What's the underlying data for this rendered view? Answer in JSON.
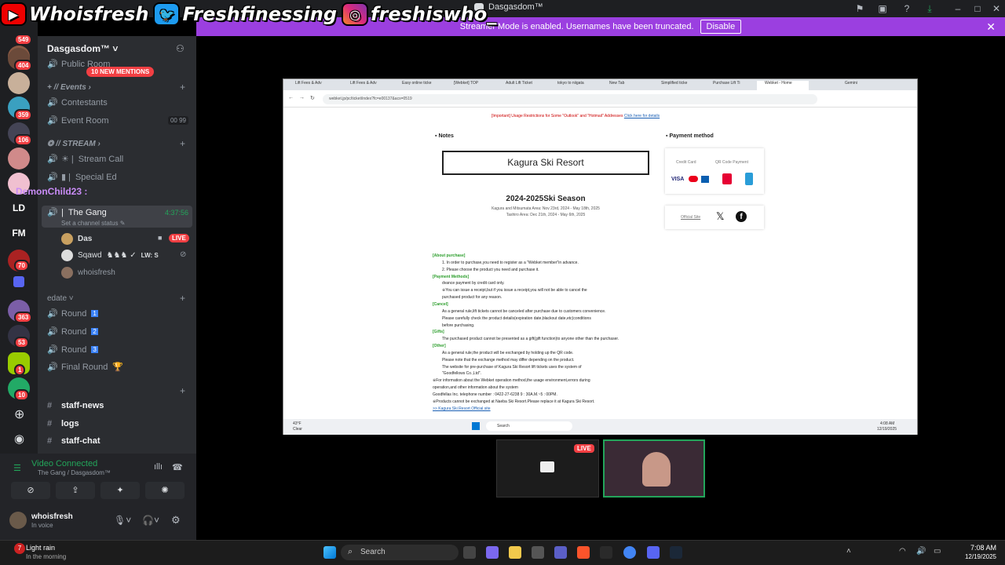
{
  "overlay": {
    "youtube": "Whoisfresh",
    "twitter": "Freshfinessing",
    "instagram": "freshiswho_"
  },
  "window": {
    "title": "Dasgasdom™"
  },
  "banner": {
    "text": "Streamer Mode is enabled. Usernames have been truncated.",
    "button": "Disable"
  },
  "rail": {
    "badges": [
      "549",
      "404",
      "359",
      "106",
      "70",
      "363",
      "53",
      "1",
      "10"
    ],
    "text_items": [
      "LD",
      "FM"
    ]
  },
  "server": {
    "name": "Dasgasdom™",
    "mentions": "10 NEW MENTIONS"
  },
  "channels": {
    "public_room": "Public Room",
    "events_cat": "// Events",
    "contestants": "Contestants",
    "event_room": "Event Room",
    "event_room_badge_1": "00",
    "event_room_badge_2": "99",
    "stream_cat": "// STREAM",
    "stream_call": "Stream Call",
    "special_ed": "Special Ed",
    "the_gang": "The Gang",
    "gang_time": "4:37:56",
    "gang_status": "Set a channel status",
    "voice_users": [
      "Das",
      "Sqawd",
      "whoisfresh"
    ],
    "sqawd_tag": "LW: S",
    "live": "LIVE",
    "edate_cat": "edate",
    "round1": "Round",
    "round2": "Round",
    "round3": "Round",
    "final_round": "Final Round",
    "staff_news": "staff-news",
    "logs": "logs",
    "staff_chat": "staff-chat"
  },
  "typing_user": "DemonChild23 :",
  "voice": {
    "title": "Video Connected",
    "sub": "The Gang / Dasgasdom™"
  },
  "user": {
    "name": "whoisfresh",
    "status": "In voice"
  },
  "browser": {
    "tabs": [
      "Lift Fees & Adv",
      "Lift Fees & Adv",
      "Easy online ticke",
      "[Webket] TOP",
      "Adult Lift Ticket",
      "tokyo to niigata",
      "New Tab",
      "Simplified ticke",
      "Purchase Lift Ti",
      "Webket - Home"
    ],
    "gemini": "Gemini",
    "url": "webket.jp/pc/ticket/index?fc=e00137&acs=0519",
    "notice": "[Important] Usage Restrictions for Some \"Outlook\" and \"Hotmail\" Addresses",
    "notice_link": "Click here for details",
    "notes_heading": "Notes",
    "payment_heading": "Payment method",
    "resort": "Kagura Ski Resort",
    "season": "2024-2025Ski Season",
    "season_line1": "Kagura and Mitsumata Area: Nov 23rd, 2024 - May 18th, 2025",
    "season_line2": "Tashiro Area: Dec 21th, 2024 - May 6th, 2025",
    "credit_card": "Credit Card",
    "qr_payment": "QR Code Payment",
    "official_site": "Official Site",
    "info": [
      {
        "t": "[About purchase]",
        "s": "g"
      },
      {
        "t": "1.  In order to purchase,you need to register as a \"Webket member\"in advance.",
        "s": "i"
      },
      {
        "t": "2.  Please choose the product you need and purchase it.",
        "s": "i"
      },
      {
        "t": "[Payment Methods]",
        "s": "g"
      },
      {
        "t": "dvance payment by credit card only.",
        "s": "i"
      },
      {
        "t": "※You can issue a receipt,but if you issue a receipt,you will not be able to cancel the",
        "s": "i"
      },
      {
        "t": "purchased product for any reason.",
        "s": "i"
      },
      {
        "t": "[Cancel]",
        "s": "g"
      },
      {
        "t": "As a general rule,lift tickets cannot be canceled after purchase due to customers convenience.",
        "s": "i"
      },
      {
        "t": "Please carefully check the product details(expiration date,blackout date,etc)conditions",
        "s": "i"
      },
      {
        "t": "before purchasing.",
        "s": "i"
      },
      {
        "t": "[Gifts]",
        "s": "g"
      },
      {
        "t": "The purchased product cannot be presented as a gift(gift function)to anyone other than the purchaser.",
        "s": "i"
      },
      {
        "t": "[Other]",
        "s": "g"
      },
      {
        "t": "As a general rule,the product will be exchanged by holding up the QR code.",
        "s": "i"
      },
      {
        "t": "Please note that the exchange method may differ depending on the product.",
        "s": "i"
      },
      {
        "t": "The website for pre-purchase of Kagura Ski Resort lift tickets uses the system of",
        "s": "i"
      },
      {
        "t": "\"Goodfellows Co.,Ltd\".",
        "s": "i"
      },
      {
        "t": "※For information about the Webket operation method,the usage environment,errors during",
        "s": "n"
      },
      {
        "t": "operation,and other information about the system",
        "s": "n"
      },
      {
        "t": "Goodfellas Inc. telephone number : 0422-27-6238  9 : 30A.M.~5 : 00PM.",
        "s": "n"
      },
      {
        "t": "※Products cannot be exchanged at Naeba Ski Resort.Please replace it at Kagura Ski Resort.",
        "s": "n"
      },
      {
        "t": ">> Kagura Ski Resort Official site",
        "s": "l"
      }
    ],
    "taskbar_search": "Search",
    "taskbar_temp": "43°F",
    "taskbar_weather": "Clear",
    "taskbar_time": "4:08 AM",
    "taskbar_date": "12/19/2025"
  },
  "tile_live": "LIVE",
  "taskbar": {
    "weather": "Light rain",
    "weather_sub": "In the morning",
    "weather_badge": "7",
    "search": "Search",
    "time": "7:08 AM",
    "date": "12/19/2025"
  },
  "colors": {
    "discord_bg": "#2b2d31",
    "rail_bg": "#1e1f22",
    "banner": "#9b3fe0",
    "live": "#f23f43",
    "connected": "#23a55a"
  }
}
